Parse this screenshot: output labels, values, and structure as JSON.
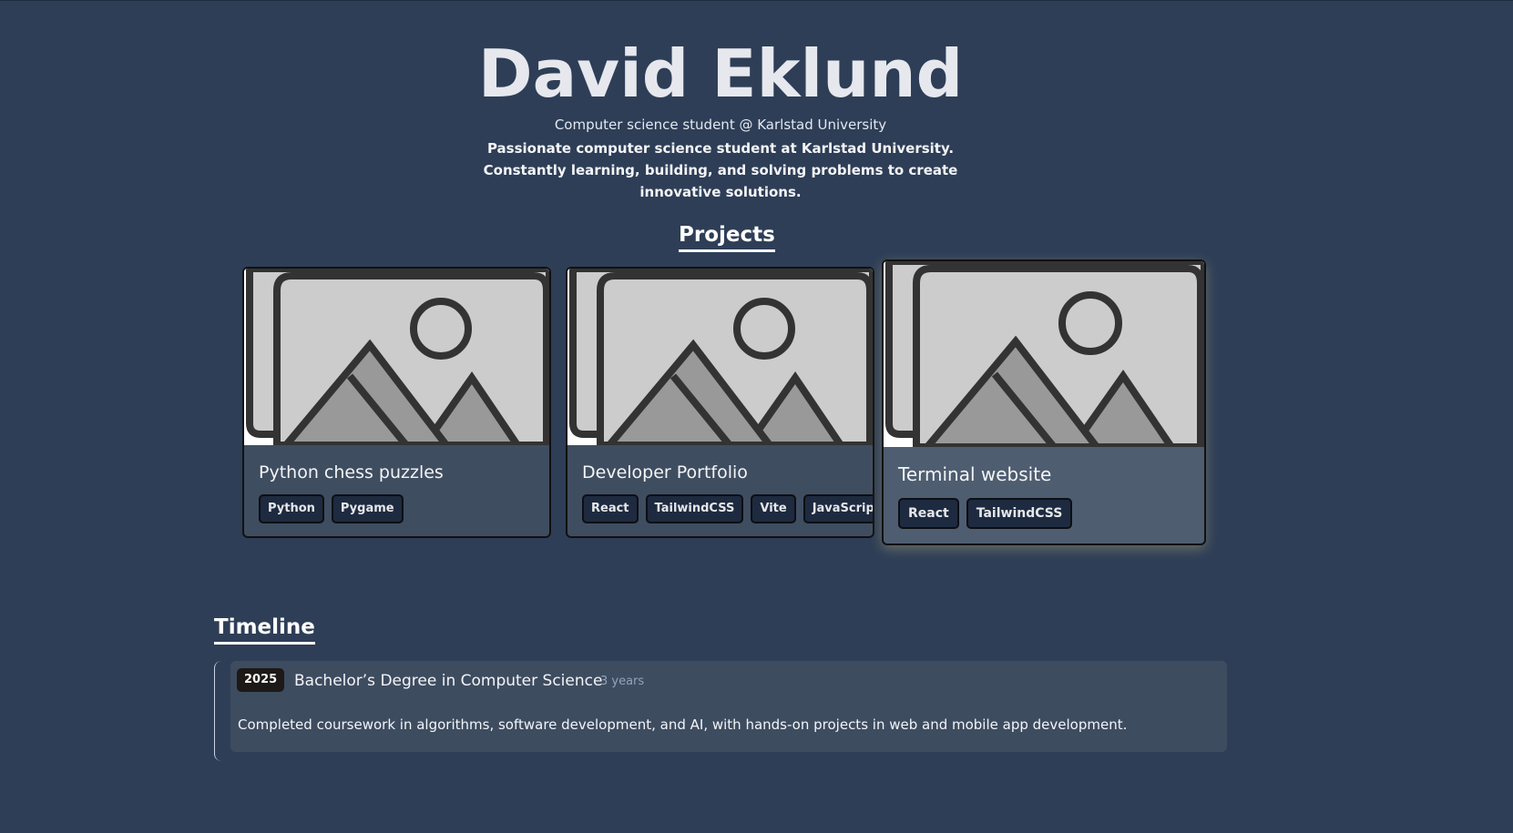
{
  "profile": {
    "name": "David Eklund",
    "role": "Computer science student @ Karlstad University",
    "bio": "Passionate computer science student at Karlstad University. Constantly learning, building, and solving problems to create innovative solutions."
  },
  "projects": {
    "title": "Projects",
    "items": [
      {
        "title": "Python chess puzzles",
        "tags": [
          "Python",
          "Pygame"
        ]
      },
      {
        "title": "Developer Portfolio",
        "tags": [
          "React",
          "TailwindCSS",
          "Vite",
          "JavaScript"
        ]
      },
      {
        "title": "Terminal website",
        "tags": [
          "React",
          "TailwindCSS"
        ]
      }
    ]
  },
  "timeline": {
    "title": "Timeline",
    "items": [
      {
        "year": "2025",
        "title": "Bachelor’s Degree in Computer Science",
        "duration": "3 years",
        "description": "Completed coursework in algorithms, software development, and AI, with hands-on projects in web and mobile app development."
      }
    ]
  },
  "colors": {
    "background": "#2e3e57",
    "card": "#3f4d60",
    "card_hover": "#4e5d70",
    "tag_bg": "#1e2a3f",
    "year_badge": "#1c1917"
  }
}
